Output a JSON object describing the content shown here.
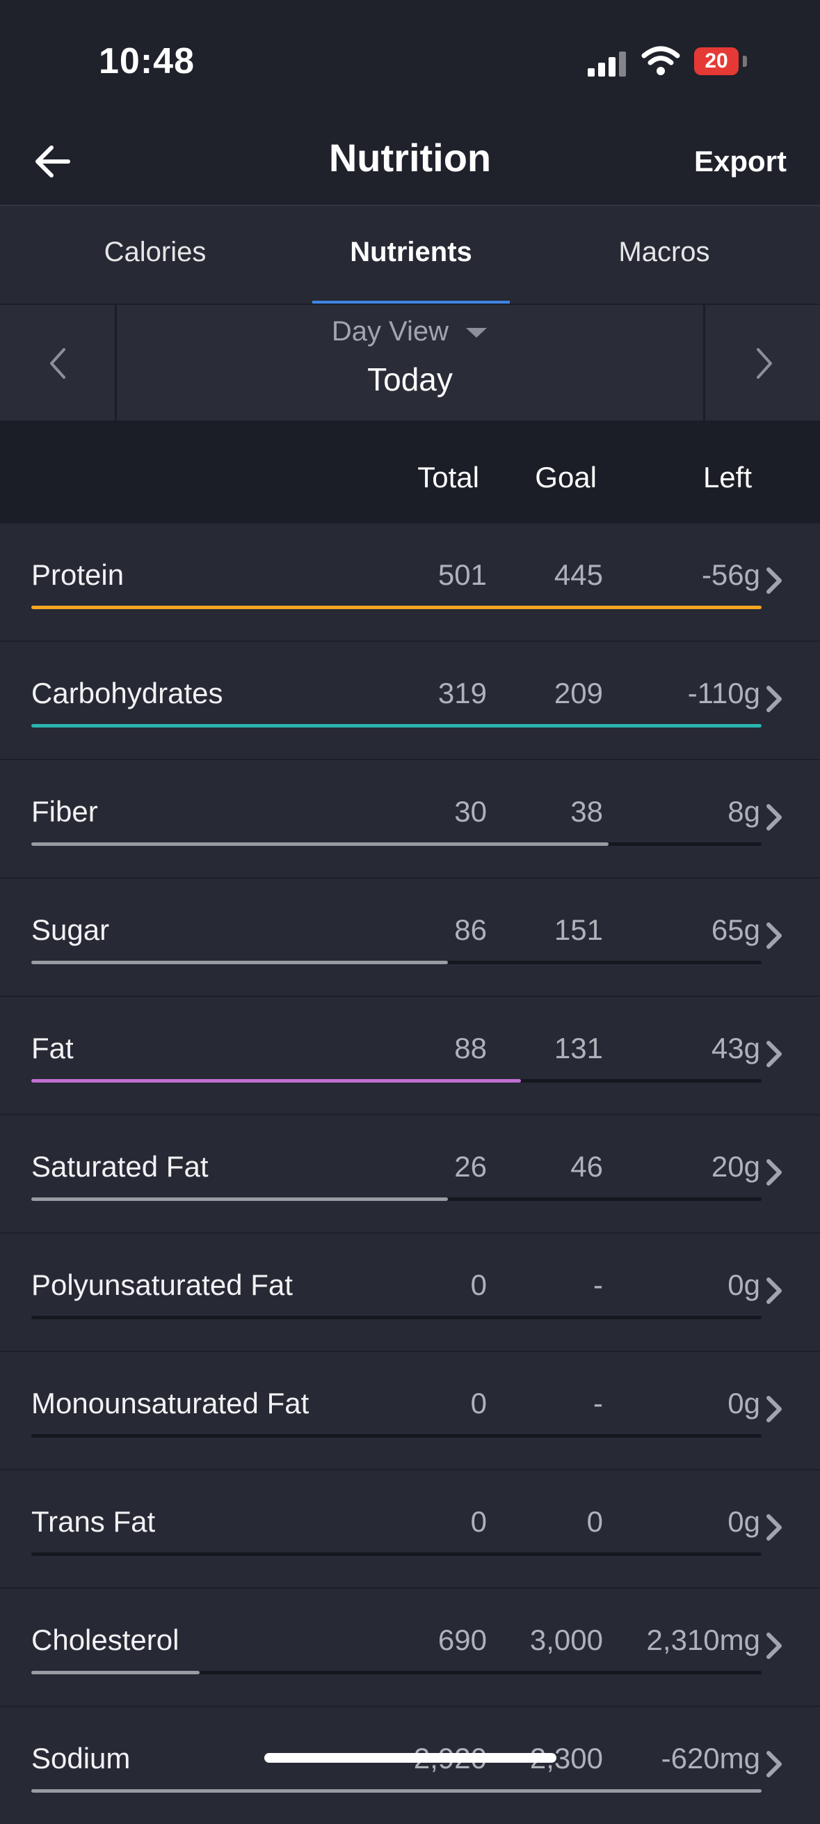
{
  "status_bar": {
    "time": "10:48",
    "battery": "20"
  },
  "nav": {
    "title": "Nutrition",
    "export_label": "Export"
  },
  "tabs": [
    {
      "label": "Calories",
      "active": false
    },
    {
      "label": "Nutrients",
      "active": true
    },
    {
      "label": "Macros",
      "active": false
    }
  ],
  "day_view": {
    "label": "Day View",
    "date": "Today"
  },
  "table": {
    "columns": {
      "total": "Total",
      "goal": "Goal",
      "left": "Left"
    },
    "rows": [
      {
        "name": "Protein",
        "total": "501",
        "goal": "445",
        "left": "-56g",
        "progress": 1.0,
        "color": "#f5a623"
      },
      {
        "name": "Carbohydrates",
        "total": "319",
        "goal": "209",
        "left": "-110g",
        "progress": 1.0,
        "color": "#2ab5ae"
      },
      {
        "name": "Fiber",
        "total": "30",
        "goal": "38",
        "left": "8g",
        "progress": 0.79,
        "color": "#9a9ca3"
      },
      {
        "name": "Sugar",
        "total": "86",
        "goal": "151",
        "left": "65g",
        "progress": 0.57,
        "color": "#9a9ca3"
      },
      {
        "name": "Fat",
        "total": "88",
        "goal": "131",
        "left": "43g",
        "progress": 0.67,
        "color": "#c26fd3"
      },
      {
        "name": "Saturated Fat",
        "total": "26",
        "goal": "46",
        "left": "20g",
        "progress": 0.57,
        "color": "#9a9ca3"
      },
      {
        "name": "Polyunsaturated Fat",
        "total": "0",
        "goal": "-",
        "left": "0g",
        "progress": 0,
        "color": "#9a9ca3"
      },
      {
        "name": "Monounsaturated Fat",
        "total": "0",
        "goal": "-",
        "left": "0g",
        "progress": 0,
        "color": "#9a9ca3"
      },
      {
        "name": "Trans Fat",
        "total": "0",
        "goal": "0",
        "left": "0g",
        "progress": 0,
        "color": "#9a9ca3"
      },
      {
        "name": "Cholesterol",
        "total": "690",
        "goal": "3,000",
        "left": "2,310mg",
        "progress": 0.23,
        "color": "#9a9ca3"
      },
      {
        "name": "Sodium",
        "total": "2,920",
        "goal": "2,300",
        "left": "-620mg",
        "progress": 1.0,
        "color": "#9a9ca3"
      }
    ]
  }
}
